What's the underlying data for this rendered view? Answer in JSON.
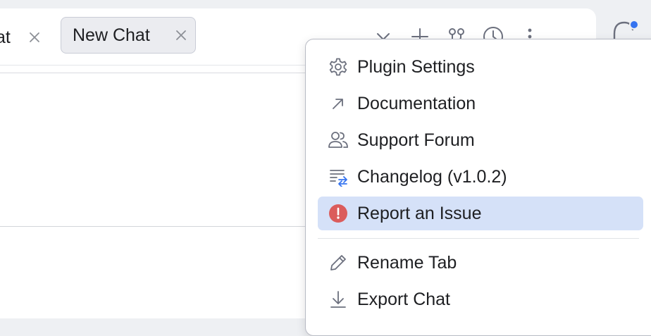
{
  "tabs": [
    {
      "label": "at",
      "active": false
    },
    {
      "label": "New Chat",
      "active": true
    }
  ],
  "toolbar": {
    "icons": [
      "chevron-down-icon",
      "plus-icon",
      "branch-icon",
      "history-icon",
      "more-vertical-icon",
      "minimize-icon"
    ]
  },
  "sidebar": {
    "icon": "notifications-bell-icon",
    "badge_color": "#3574f0"
  },
  "menu": {
    "items": [
      {
        "label": "Plugin Settings",
        "icon": "gear-icon"
      },
      {
        "label": "Documentation",
        "icon": "external-link-arrow-icon"
      },
      {
        "label": "Support Forum",
        "icon": "users-icon"
      },
      {
        "label": "Changelog (v1.0.2)",
        "icon": "changelog-icon"
      },
      {
        "label": "Report an Issue",
        "icon": "error-circle-icon",
        "highlighted": true
      },
      {
        "label": "Rename Tab",
        "icon": "pencil-icon"
      },
      {
        "label": "Export Chat",
        "icon": "download-icon"
      }
    ]
  },
  "colors": {
    "highlight": "#d5e1f8",
    "error": "#db5c5c",
    "accent": "#3574f0",
    "changelog_icon": "#3574f0"
  }
}
